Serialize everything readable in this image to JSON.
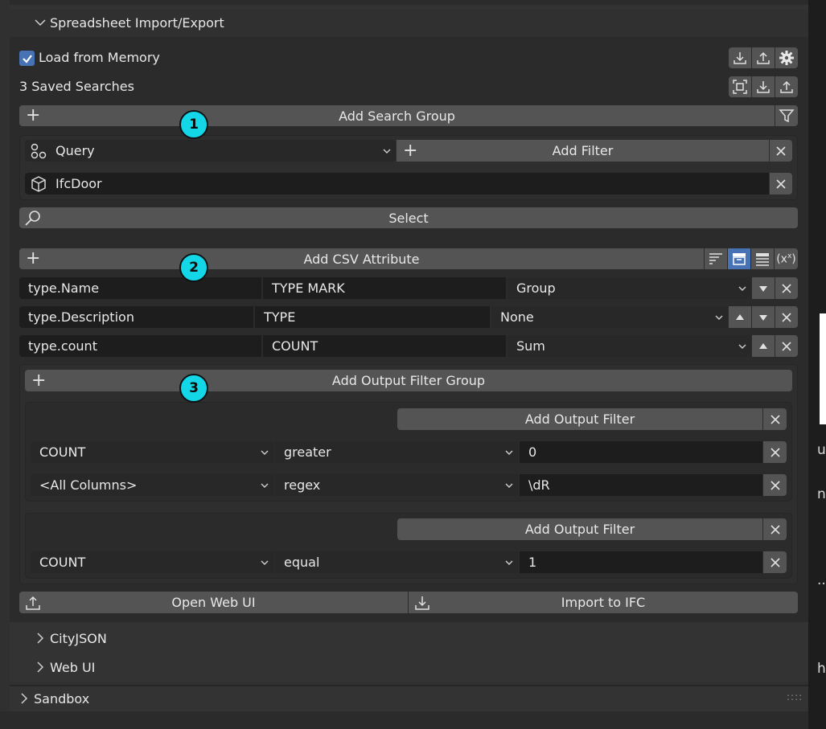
{
  "sections": {
    "spreadsheet": "Spreadsheet Import/Export",
    "cityjson": "CityJSON",
    "webui": "Web UI",
    "sandbox": "Sandbox"
  },
  "load_from_memory": {
    "label": "Load from Memory",
    "checked": true
  },
  "saved_searches": "3 Saved Searches",
  "search": {
    "add_group": "Add Search Group",
    "query_select": "Query",
    "add_filter": "Add Filter",
    "class_value": "IfcDoor",
    "select": "Select"
  },
  "csv": {
    "add_attribute": "Add CSV Attribute",
    "rows": [
      {
        "attribute": "type.Name",
        "header": "TYPE MARK",
        "summary": "Group"
      },
      {
        "attribute": "type.Description",
        "header": "TYPE",
        "summary": "None"
      },
      {
        "attribute": "type.count",
        "header": "COUNT",
        "summary": "Sum"
      }
    ]
  },
  "output_filters": {
    "add_group": "Add Output Filter Group",
    "groups": [
      {
        "add_filter": "Add Output Filter",
        "rows": [
          {
            "column": "COUNT",
            "op": "greater",
            "value": "0"
          },
          {
            "column": "<All Columns>",
            "op": "regex",
            "value": "\\dR"
          }
        ]
      },
      {
        "add_filter": "Add Output Filter",
        "rows": [
          {
            "column": "COUNT",
            "op": "equal",
            "value": "1"
          }
        ]
      }
    ]
  },
  "footer": {
    "open_web_ui": "Open Web UI",
    "import_to_ifc": "Import to IFC"
  },
  "badges": [
    "1",
    "2",
    "3"
  ],
  "edge_text": [
    "u",
    "n",
    "..",
    "h"
  ],
  "icons": {
    "query": "query-icon",
    "class": "cube-icon",
    "select": "search-icon",
    "filter": "filter-icon"
  },
  "colors": {
    "accent": "#4772b3",
    "badge": "#13d7e6"
  }
}
